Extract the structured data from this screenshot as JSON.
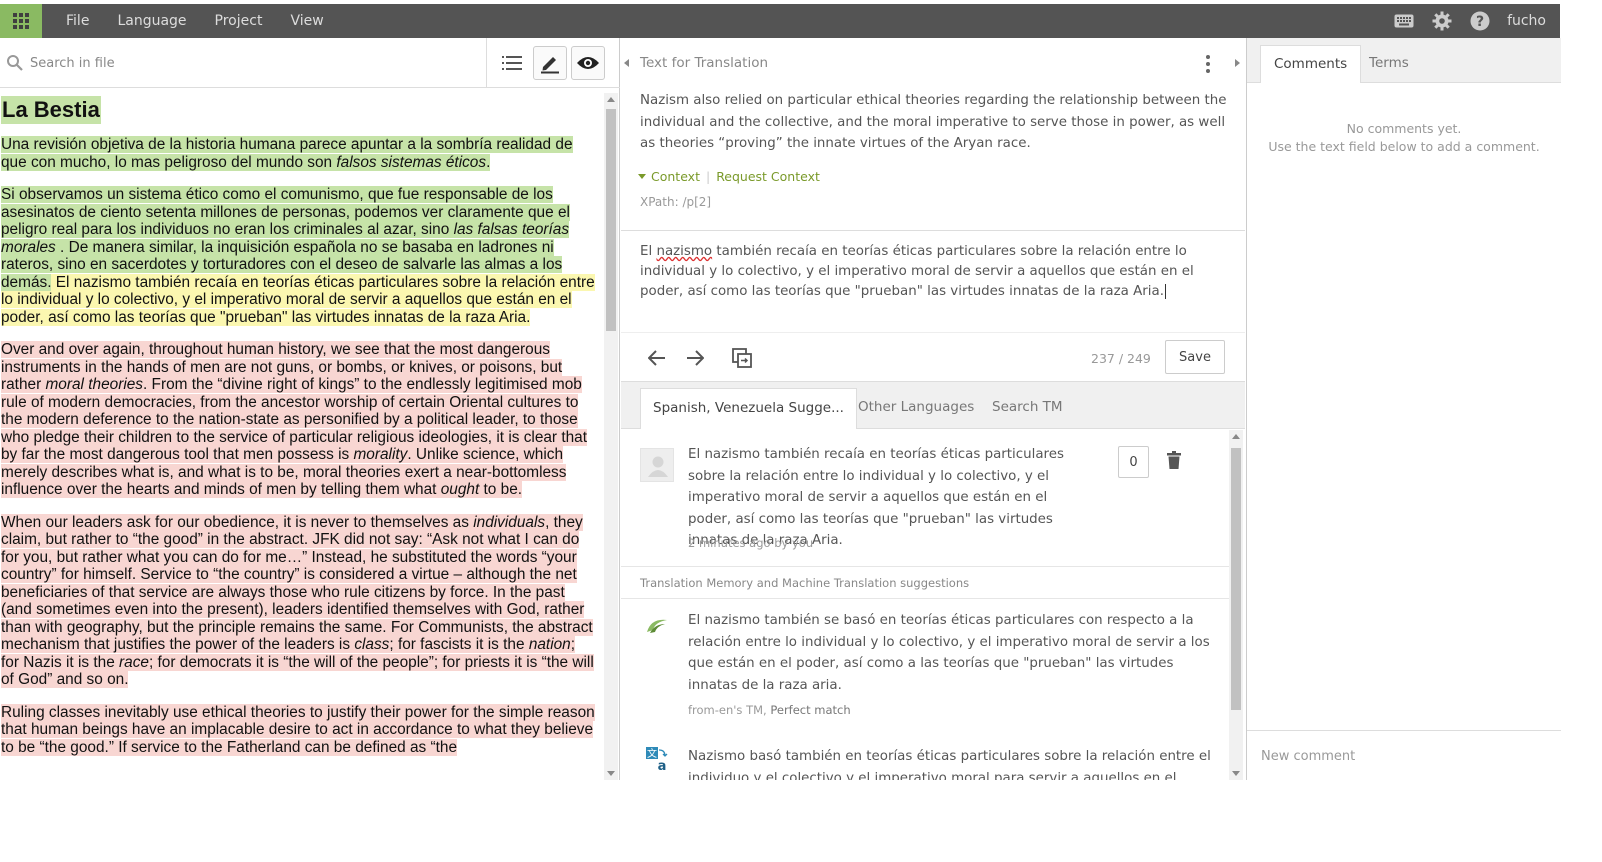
{
  "menu": {
    "items": [
      "File",
      "Language",
      "Project",
      "View"
    ],
    "username": "fucho"
  },
  "source_pane": {
    "search_placeholder": "Search in file",
    "document": {
      "title": "La Bestia",
      "p1_a": "Una revisión objetiva de la historia humana parece apuntar a la sombría realidad de que con mucho, lo mas peligroso del mundo son ",
      "p1_em": "falsos sistemas éticos",
      "p1_b": ".",
      "p2_a": "Si observamos un sistema ético como el comunismo, que fue responsable de los asesinatos de ciento setenta millones de personas, podemos ver claramente que el peligro real para los individuos no eran los criminales al azar, sino ",
      "p2_em": "las falsas teorías morales",
      "p2_b": " . De manera similar, la inquisición española no se basaba en ladrones ni rateros, sino en sacerdotes y torturadores con el deseo de salvarle las almas a los demás.",
      "p2_c": " El nazismo también recaía en teorías éticas particulares sobre la relación entre lo individual y lo colectivo, y el imperativo moral de servir a aquellos que están en el poder, así como las teorías que \"prueban\" las virtudes innatas de la raza Aria.",
      "p3_a": "Over and over again, throughout human history, we see that the most dangerous instruments in the hands of men are not guns, or bombs, or knives, or poisons, but rather ",
      "p3_em1": "moral theories",
      "p3_b": ". From the “divine right of kings” to the endlessly legitimised mob rule of modern democracies, from the ancestor worship of certain Oriental cultures to the modern deference to the nation-state as personified by a political leader, to those who pledge their children to the service of particular religious ideologies, it is clear that by far the most dangerous tool that men possess is ",
      "p3_em2": "morality",
      "p3_c": ". Unlike science, which merely describes what is, and what is to be, moral theories exert a near-bottomless influence over the hearts and minds of men by telling them what ",
      "p3_em3": "ought",
      "p3_d": " to be.",
      "p4_a": "When our leaders ask for our obedience, it is never to themselves as ",
      "p4_em1": "individuals",
      "p4_b": ", they claim, but rather to “the good” in the abstract. JFK did not say: “Ask not what I can do for you, but rather what you can do for me…” Instead, he substituted the words “your country” for himself. Service to “the country” is considered a virtue – although the net beneficiaries of that service are always those who rule citizens by force. In the past (and sometimes even into the present), leaders identified themselves with God, rather than with geography, but the principle remains the same. For Communists, the abstract mechanism that justifies the power of the leaders is ",
      "p4_em2": "class",
      "p4_c": "; for fascists it is the ",
      "p4_em3": "nation",
      "p4_d": "; for Nazis it is the ",
      "p4_em4": "race",
      "p4_e": "; for democrats it is “the will of the people”; for priests it is “the will of God” and so on.",
      "p5": "Ruling classes inevitably use ethical theories to justify their power for the simple reason that human beings have an implacable desire to act in accordance to what they believe to be “the good.” If service to the Fatherland can be defined as “the"
    }
  },
  "editor": {
    "header": "Text for Translation",
    "source_text": "Nazism also relied on particular ethical theories regarding the relationship between the individual and the collective, and the moral imperative to serve those in power, as well as theories “proving” the innate virtues of the Aryan race.",
    "context_label": "Context",
    "request_context_label": "Request Context",
    "xpath": "XPath: /p[2]",
    "target_pre": "El ",
    "target_misspelled": "nazismo",
    "target_post": " también recaía en teorías éticas particulares sobre la relación entre lo individual y lo colectivo, y el imperativo moral de servir a aquellos que están en el poder, así como las teorías que \"prueban\" las virtudes innatas de la raza Aria.",
    "counter": "237 / 249",
    "save_label": "Save"
  },
  "suggestion_tabs": [
    "Spanish, Venezuela Sugge...",
    "Other Languages",
    "Search TM"
  ],
  "suggestions": {
    "user": {
      "text": "El nazismo también recaía en teorías éticas particulares sobre la relación entre lo individual y lo colectivo, y el imperativo moral de servir a aquellos que están en el poder, así como las teorías que \"prueban\" las virtudes innatas de la raza Aria.",
      "meta": "2 minutes ago by you",
      "votes": "0"
    },
    "tm_header": "Translation Memory and Machine Translation suggestions",
    "tm1": {
      "text": "El nazismo también se basó en teorías éticas particulares con respecto a la relación entre lo individual y lo colectivo, y el imperativo moral de servir a los que están en el poder, así como a las teorías que \"prueban\" las virtudes innatas de la raza aria.",
      "meta_source": "from-en's TM, ",
      "meta_match": "Perfect match"
    },
    "mt1": {
      "text": "Nazismo basó también en teorías éticas particulares sobre la relación entre el individuo y el colectivo y el imperativo moral para servir a aquellos en el poder"
    }
  },
  "comments": {
    "tabs": [
      "Comments",
      "Terms"
    ],
    "empty_line1": "No comments yet.",
    "empty_line2": "Use the text field below to add a comment.",
    "new_placeholder": "New comment"
  },
  "colors": {
    "accent_green": "#8aba62",
    "translated_bg": "#c6e3a8",
    "current_bg": "#fbf7b0",
    "untranslated_bg": "#f8d6d2"
  }
}
